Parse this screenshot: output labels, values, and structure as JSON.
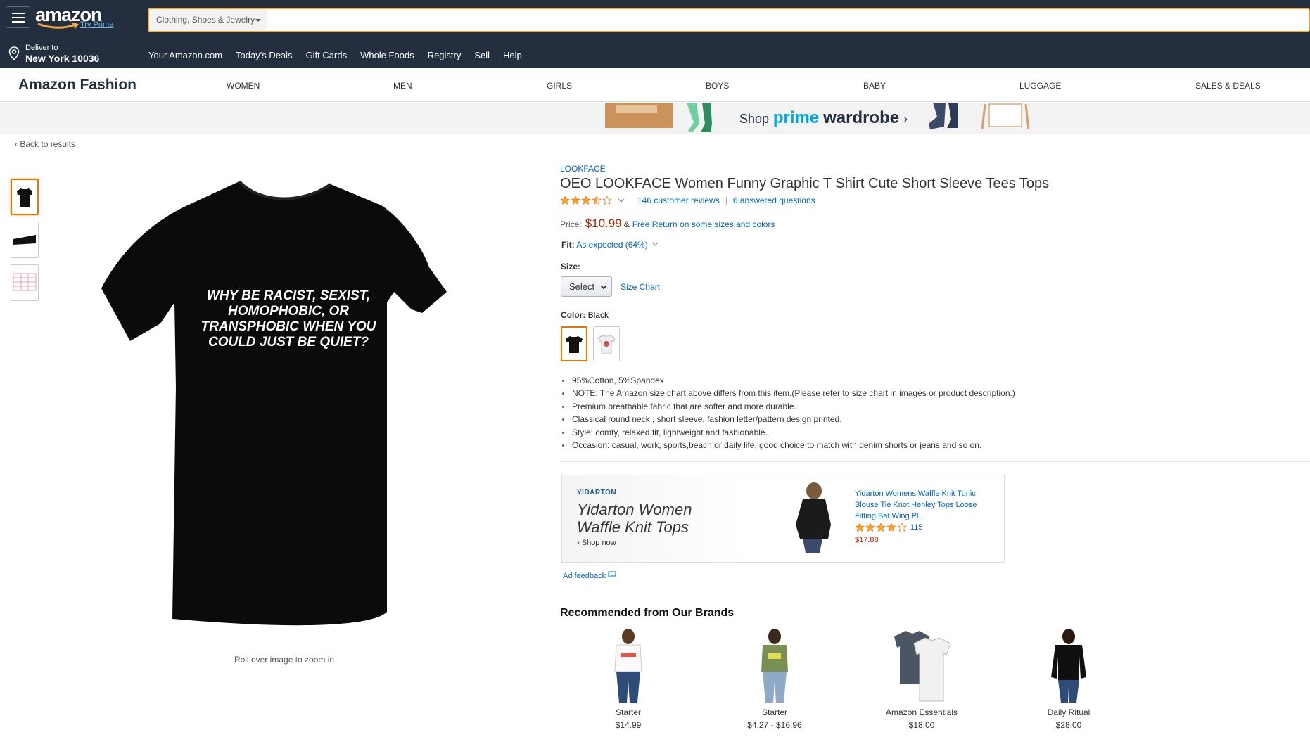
{
  "header": {
    "logo_text": "amazon",
    "try_prime": "Try Prime",
    "search_category": "Clothing, Shoes & Jewelry",
    "search_placeholder": "",
    "deliver_line1": "Deliver to",
    "deliver_line2": "New York 10036",
    "nav_links": [
      "Your Amazon.com",
      "Today's Deals",
      "Gift Cards",
      "Whole Foods",
      "Registry",
      "Sell",
      "Help"
    ]
  },
  "fashion_nav": {
    "title": "Amazon Fashion",
    "categories": [
      "WOMEN",
      "MEN",
      "GIRLS",
      "BOYS",
      "BABY",
      "LUGGAGE",
      "SALES & DEALS"
    ]
  },
  "banner": {
    "shop": "Shop",
    "prime": "prime",
    "wardrobe": "wardrobe",
    "arrow": "›",
    "box_text": "prime wardrobe"
  },
  "back_link": "Back to results",
  "gallery": {
    "shirt_text": "WHY BE RACIST, SEXIST, HOMOPHOBIC, OR TRANSPHOBIC WHEN YOU COULD JUST BE QUIET?",
    "zoom_hint": "Roll over image to zoom in"
  },
  "product": {
    "brand": "LOOKFACE",
    "title": "OEO LOOKFACE Women Funny Graphic T Shirt Cute Short Sleeve Tees Tops",
    "rating": 3.5,
    "reviews": "146 customer reviews",
    "separator": "|",
    "questions": "6 answered questions",
    "price_label": "Price:",
    "price": "$10.99",
    "amp": "&",
    "free_return": "Free Return on some sizes and colors",
    "fit_label": "Fit:",
    "fit_value": "As expected (64%)",
    "size_label": "Size:",
    "size_select": "Select",
    "size_chart": "Size Chart",
    "color_label": "Color:",
    "color_value": "Black",
    "bullets": [
      "95%Cotton, 5%Spandex",
      "NOTE: The Amazon size chart above differs from this item.(Please refer to size chart in images or product description.)",
      "Premium breathable fabric that are softer and more durable.",
      "Classical round neck , short sleeve, fashion letter/pattern design printed.",
      "Style: comfy, relaxed fit, lightweight and fashionable.",
      "Occasion: casual, work, sports,beach or daily life, good choice to match with denim shorts or jeans and so on."
    ]
  },
  "ad": {
    "brand": "YIDARTON",
    "headline_l1": "Yidarton Women",
    "headline_l2": "Waffle Knit Tops",
    "shop_now": "Shop now",
    "product_title": "Yidarton Womens Waffle Knit Tunic Blouse Tie Knot Henley Tops Loose Fitting Bat Wing Pl...",
    "rating": 4,
    "count": "115",
    "price": "$17.88",
    "feedback": "Ad feedback"
  },
  "recommended": {
    "title": "Recommended from Our Brands",
    "items": [
      {
        "name": "Starter",
        "price": "$14.99"
      },
      {
        "name": "Starter",
        "price": "$4.27 - $16.96"
      },
      {
        "name": "Amazon Essentials",
        "price": "$18.00"
      },
      {
        "name": "Daily Ritual",
        "price": "$28.00"
      }
    ]
  },
  "colors": {
    "header_bg": "#232f3e",
    "accent": "#f3a847",
    "link": "#0066c0",
    "price": "#b12704",
    "star": "#ffa41c"
  }
}
